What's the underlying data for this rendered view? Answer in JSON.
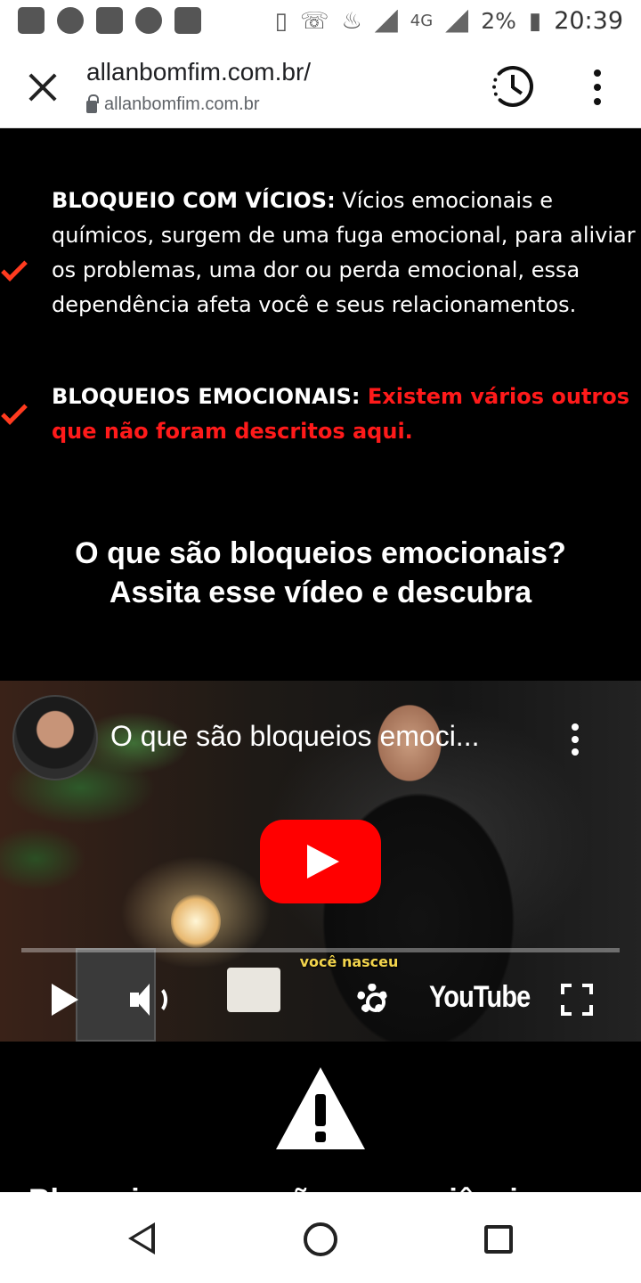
{
  "status_bar": {
    "battery": "2%",
    "time": "20:39",
    "network": "4G"
  },
  "browser": {
    "title": "allanbomfim.com.br/",
    "url": "allanbomfim.com.br",
    "icons": [
      "close-icon",
      "lock-icon",
      "history-icon",
      "more-vert-icon"
    ]
  },
  "items": [
    {
      "label": "BLOQUEIO COM VÍCIOS:",
      "text": " Vícios emocionais e químicos, surgem de uma fuga emocional, para aliviar os problemas, uma dor ou perda emocional, essa dependência afeta você e seus relacionamentos.",
      "icon": "check-icon"
    },
    {
      "label": "BLOQUEIOS EMOCIONAIS:",
      "text": " Existem vários outros que não foram descritos aqui.",
      "text_color": "#ff1a1a",
      "icon": "check-icon"
    }
  ],
  "heading": {
    "line1": "O que são bloqueios emocionais?",
    "line2": "Assita esse vídeo e descubra"
  },
  "video": {
    "title": "O que são bloqueios emoci...",
    "caption": "você nasceu",
    "brand": "YouTube"
  },
  "cut_text": "Bloqueio no coração e consciência",
  "colors": {
    "accent": "#ff3b1f",
    "youtube_red": "#ff0000",
    "background": "#000000"
  }
}
